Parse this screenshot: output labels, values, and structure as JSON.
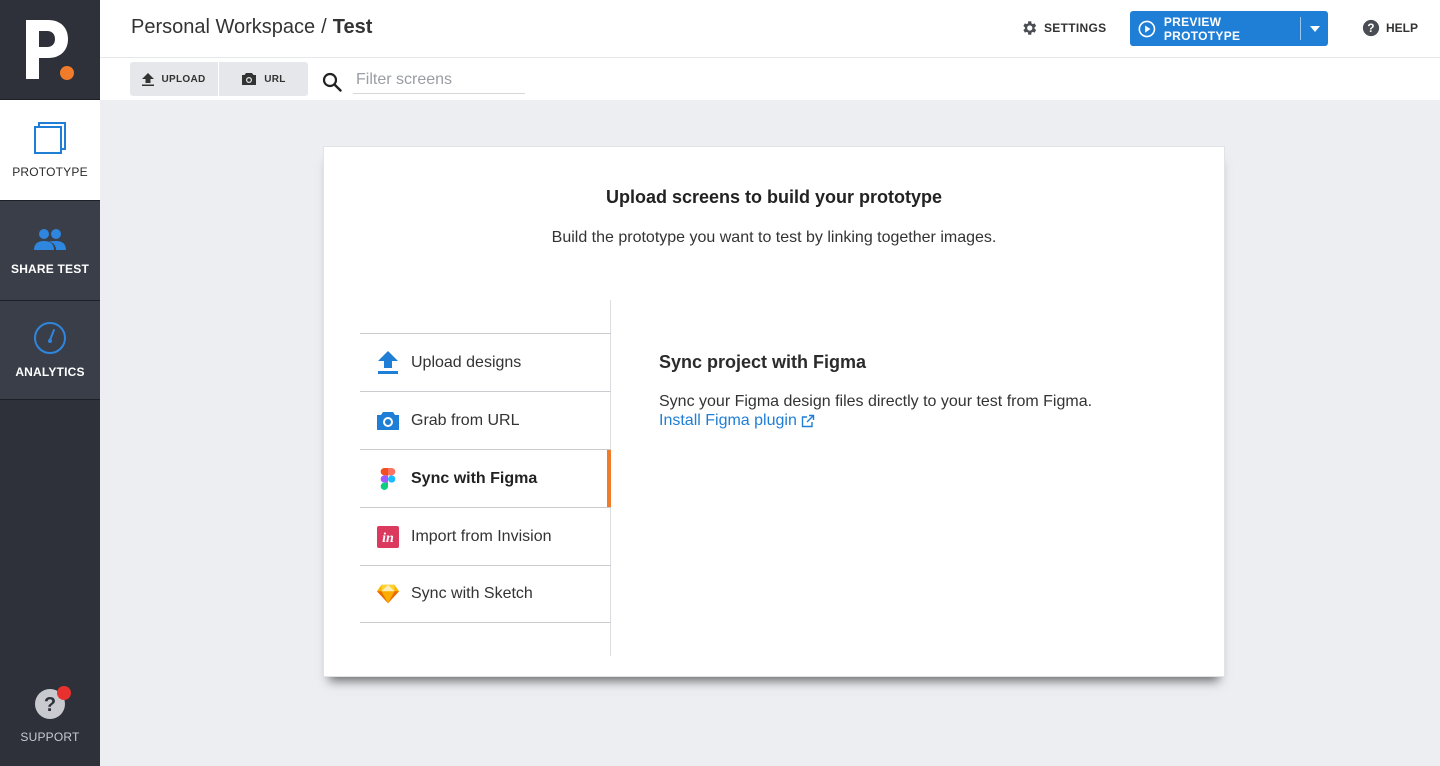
{
  "sidebar": {
    "items": [
      {
        "label": "PROTOTYPE"
      },
      {
        "label": "SHARE TEST"
      },
      {
        "label": "ANALYTICS"
      }
    ],
    "support_label": "SUPPORT"
  },
  "header": {
    "workspace": "Personal Workspace",
    "separator": "/",
    "project": "Test",
    "settings_label": "SETTINGS",
    "preview_label": "PREVIEW PROTOTYPE",
    "help_label": "HELP"
  },
  "toolbar": {
    "upload_label": "UPLOAD",
    "url_label": "URL",
    "search_placeholder": "Filter screens"
  },
  "card": {
    "title": "Upload screens to build your prototype",
    "subtitle": "Build the prototype you want to test by linking together images.",
    "options": [
      {
        "label": "Upload designs",
        "icon": "upload-icon"
      },
      {
        "label": "Grab from URL",
        "icon": "camera-icon"
      },
      {
        "label": "Sync with Figma",
        "icon": "figma-icon",
        "active": true
      },
      {
        "label": "Import from Invision",
        "icon": "invision-icon"
      },
      {
        "label": "Sync with Sketch",
        "icon": "sketch-icon"
      }
    ],
    "detail": {
      "title": "Sync project with Figma",
      "text": "Sync your Figma design files directly to your test from Figma.",
      "link": "Install Figma plugin"
    }
  },
  "colors": {
    "accent": "#1f7ed6",
    "active_marker": "#f07b2a",
    "sidebar": "#2e313a"
  }
}
